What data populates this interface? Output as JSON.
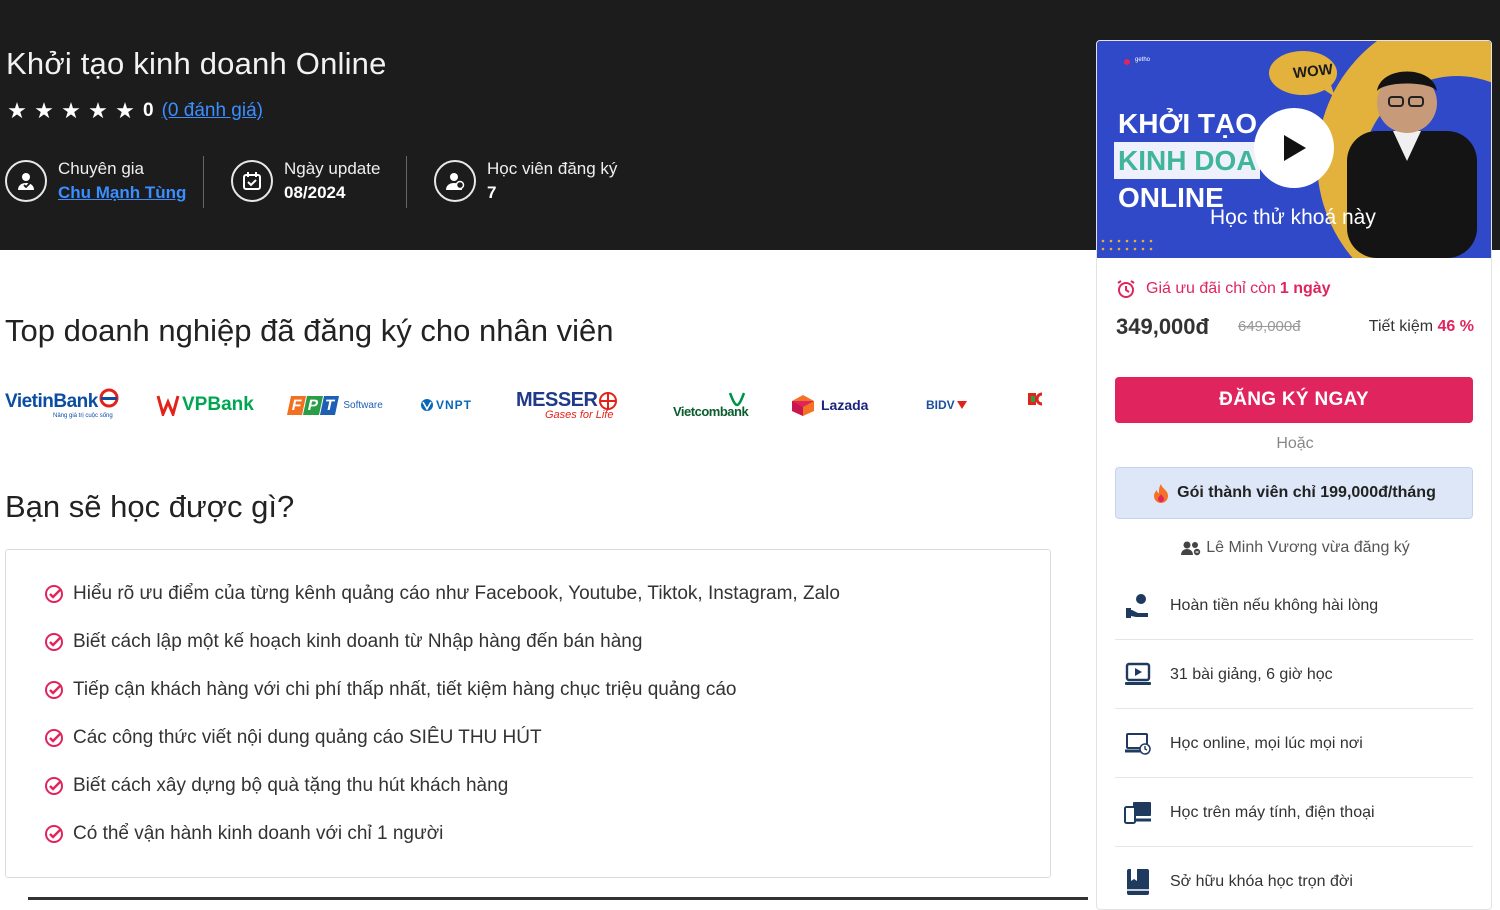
{
  "course": {
    "title": "Khởi tạo kinh doanh Online",
    "rating_value": "0",
    "rating_link": "(0 đánh giá)",
    "rating_stars": 5
  },
  "meta": {
    "expert_label": "Chuyên gia",
    "expert_name": "Chu Mạnh Tùng",
    "update_label": "Ngày update",
    "update_value": "08/2024",
    "students_label": "Học viên đăng ký",
    "students_value": "7"
  },
  "companies": {
    "title": "Top doanh nghiệp đã đăng ký cho nhân viên",
    "logos": [
      "VietinBank",
      "VPBank",
      "FPT Software",
      "VNPT",
      "MESSER",
      "Vietcombank",
      "Lazada",
      "BIDV"
    ],
    "vietinbank_tagline": "Nâng giá trị cuộc sống",
    "messer_tagline": "Gases for Life",
    "fpt_sub": "Software"
  },
  "learn": {
    "title": "Bạn sẽ học được gì?",
    "items": [
      "Hiểu rõ ưu điểm của từng kênh quảng cáo như Facebook, Youtube, Tiktok, Instagram, Zalo",
      "Biết cách lập một kế hoạch kinh doanh từ Nhập hàng đến bán hàng",
      "Tiếp cận khách hàng với chi phí thấp nhất, tiết kiệm hàng chục triệu quảng cáo",
      "Các công thức viết nội dung quảng cáo SIÊU THU HÚT",
      "Biết cách xây dựng bộ quà tặng thu hút khách hàng",
      "Có thể vận hành kinh doanh với chỉ 1 người"
    ]
  },
  "sidebar": {
    "thumb": {
      "line1": "KHỞI TẠO",
      "line2": "KINH DOA",
      "line3": "ONLINE",
      "wow": "WOW",
      "preview_label": "Học thử khoá này"
    },
    "promo_text": "Giá ưu đãi chỉ còn",
    "promo_days": "1 ngày",
    "price": "349,000đ",
    "old_price": "649,000đ",
    "saving_label": "Tiết kiệm",
    "saving_value": "46 %",
    "cta_label": "ĐĂNG KÝ NGAY",
    "or_label": "Hoặc",
    "member_label": "Gói thành viên chỉ 199,000đ/tháng",
    "recent_signup": "Lê Minh Vương vừa đăng ký",
    "features": [
      "Hoàn tiền nếu không hài lòng",
      "31 bài giảng, 6 giờ học",
      "Học online, mọi lúc mọi nơi",
      "Học trên máy tính, điện thoại",
      "Sở hữu khóa học trọn đời"
    ]
  },
  "colors": {
    "accent": "#e0245e",
    "link": "#3a8eff",
    "hero_bg": "#1c1c1c",
    "member_bg": "#dde7f7"
  },
  "icons": [
    "star-icon",
    "expert-icon",
    "calendar-icon",
    "students-icon",
    "check-icon",
    "alarm-icon",
    "play-icon",
    "fire-icon",
    "users-icon",
    "refund-icon",
    "video-icon",
    "online-icon",
    "devices-icon",
    "book-icon"
  ]
}
